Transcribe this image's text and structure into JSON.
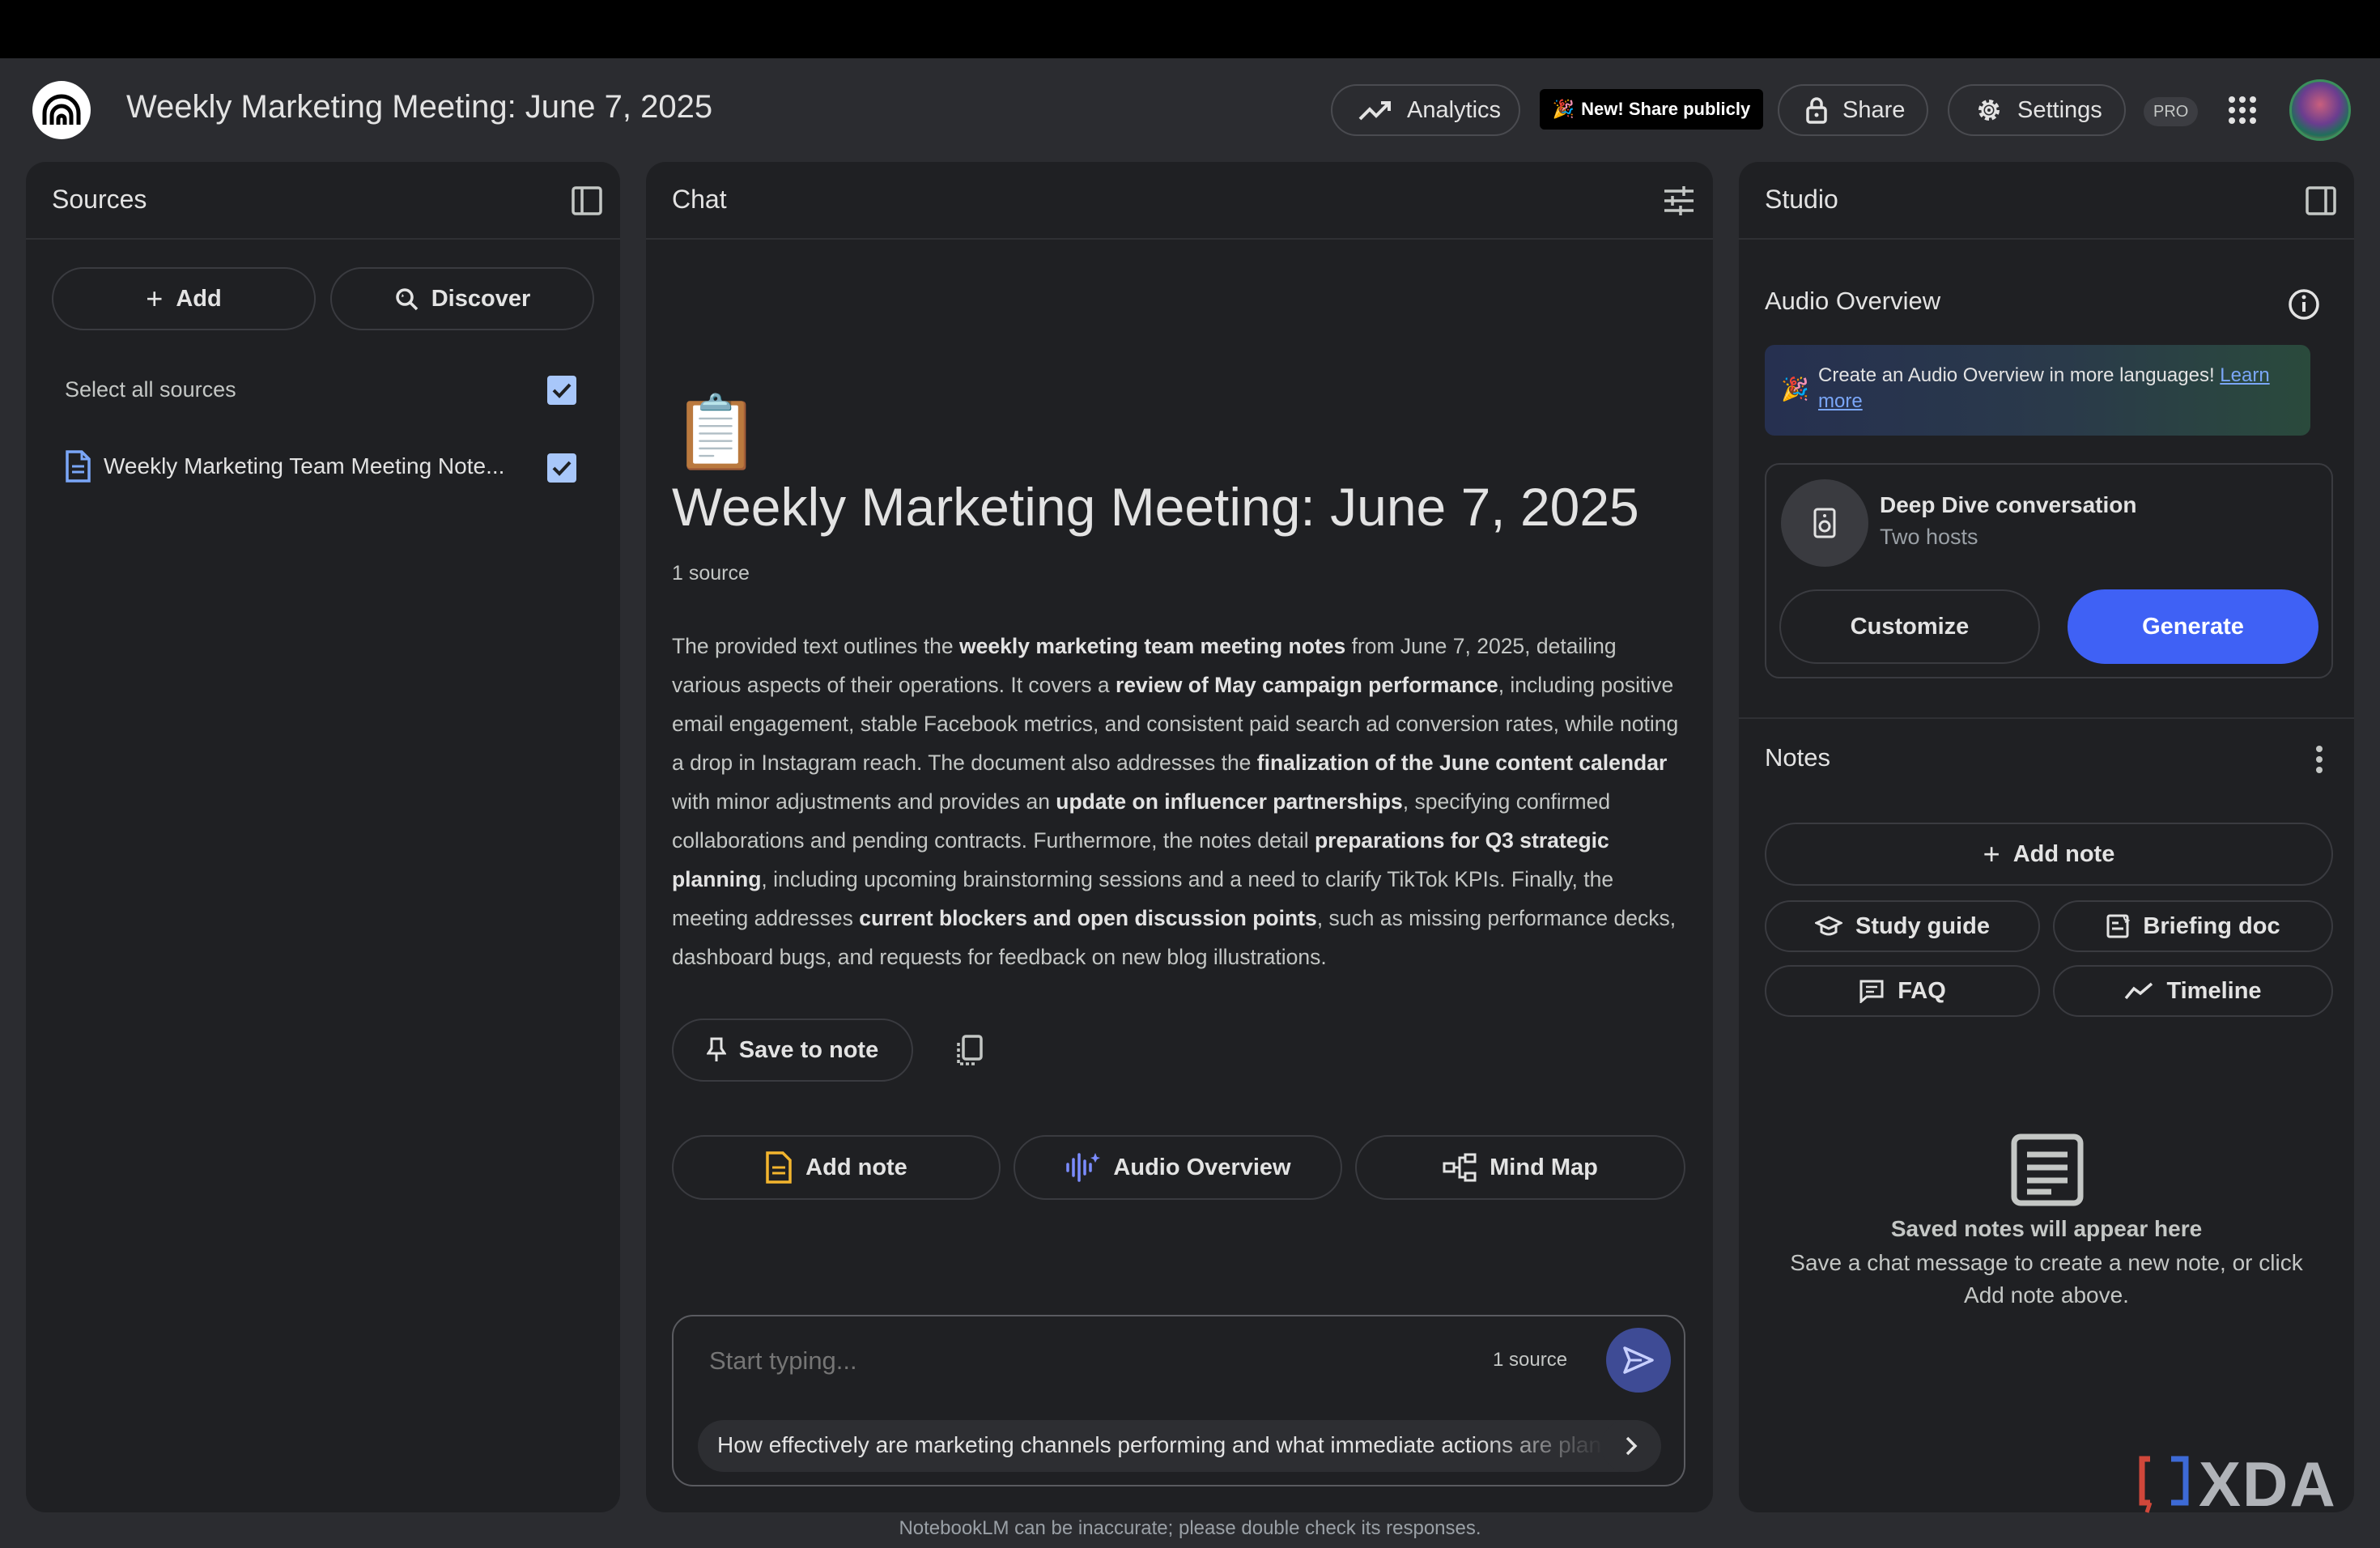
{
  "header": {
    "notebook_title": "Weekly Marketing Meeting: June 7, 2025",
    "analytics_label": "Analytics",
    "share_publicly_label": "New! Share publicly",
    "share_label": "Share",
    "settings_label": "Settings",
    "pro_label": "PRO"
  },
  "sources": {
    "title": "Sources",
    "add_label": "Add",
    "discover_label": "Discover",
    "select_all_label": "Select all sources",
    "items": [
      {
        "label": "Weekly Marketing Team Meeting Note..."
      }
    ]
  },
  "chat": {
    "title": "Chat",
    "emoji": "📋",
    "heading": "Weekly Marketing Meeting: June 7, 2025",
    "source_count": "1 source",
    "summary": [
      {
        "t": "The provided text outlines the ",
        "b": false
      },
      {
        "t": "weekly marketing team meeting notes",
        "b": true
      },
      {
        "t": " from June 7, 2025, detailing various aspects of their operations. It covers a ",
        "b": false
      },
      {
        "t": "review of May campaign performance",
        "b": true
      },
      {
        "t": ", including positive email engagement, stable Facebook metrics, and consistent paid search ad conversion rates, while noting a drop in Instagram reach. The document also addresses the ",
        "b": false
      },
      {
        "t": "finalization of the June content calendar",
        "b": true
      },
      {
        "t": " with minor adjustments and provides an ",
        "b": false
      },
      {
        "t": "update on influencer partnerships",
        "b": true
      },
      {
        "t": ", specifying confirmed collaborations and pending contracts. Furthermore, the notes detail ",
        "b": false
      },
      {
        "t": "preparations for Q3 strategic planning",
        "b": true
      },
      {
        "t": ", including upcoming brainstorming sessions and a need to clarify TikTok KPIs. Finally, the meeting addresses ",
        "b": false
      },
      {
        "t": "current blockers and open discussion points",
        "b": true
      },
      {
        "t": ", such as missing performance decks, dashboard bugs, and requests for feedback on new blog illustrations.",
        "b": false
      }
    ],
    "save_to_note_label": "Save to note",
    "add_note_label": "Add note",
    "audio_overview_label": "Audio Overview",
    "mind_map_label": "Mind Map",
    "input_placeholder": "Start typing...",
    "input_source_count": "1 source",
    "suggestion": "How effectively are marketing channels performing and what immediate actions are planned?",
    "disclaimer": "NotebookLM can be inaccurate; please double check its responses."
  },
  "studio": {
    "title": "Studio",
    "audio_overview_title": "Audio Overview",
    "banner_text": "Create an Audio Overview in more languages!",
    "banner_link": "Learn more",
    "deep_dive_title": "Deep Dive conversation",
    "deep_dive_subtitle": "Two hosts",
    "customize_label": "Customize",
    "generate_label": "Generate",
    "notes_title": "Notes",
    "add_note_label": "Add note",
    "study_guide_label": "Study guide",
    "briefing_doc_label": "Briefing doc",
    "faq_label": "FAQ",
    "timeline_label": "Timeline",
    "empty_title": "Saved notes will appear here",
    "empty_text": "Save a chat message to create a new note, or click Add note above."
  },
  "watermark": "XDA",
  "colors": {
    "accent_blue": "#3f61f5",
    "background": "#2b2c30",
    "panel": "#1f2023"
  }
}
